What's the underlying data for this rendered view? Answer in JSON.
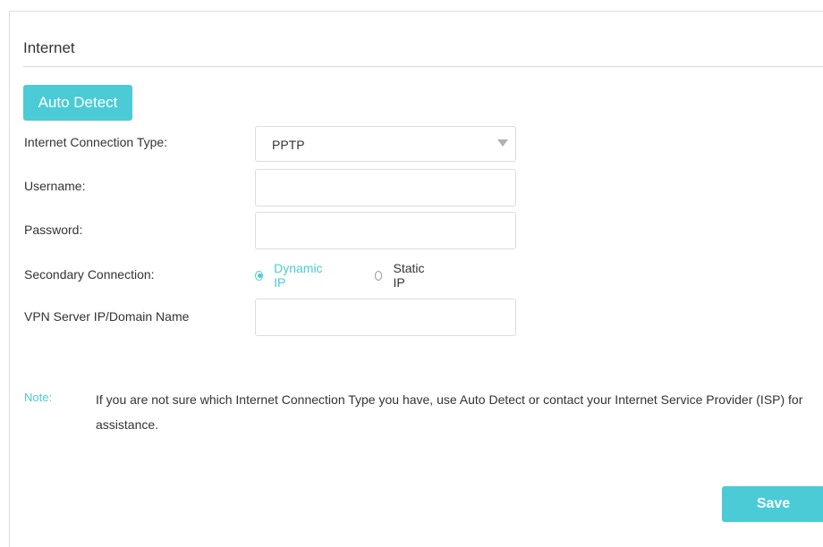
{
  "section": {
    "title": "Internet"
  },
  "auto_detect_label": "Auto Detect",
  "form": {
    "connection_type": {
      "label": "Internet Connection Type:",
      "value": "PPTP"
    },
    "username": {
      "label": "Username:",
      "value": ""
    },
    "password": {
      "label": "Password:",
      "value": ""
    },
    "secondary_connection": {
      "label": "Secondary Connection:",
      "options": [
        {
          "label": "Dynamic IP",
          "selected": true
        },
        {
          "label": "Static IP",
          "selected": false
        }
      ]
    },
    "vpn_server": {
      "label": "VPN Server IP/Domain Name",
      "value": ""
    }
  },
  "note": {
    "label": "Note:",
    "text": "If you are not sure which Internet Connection Type you have, use Auto Detect or contact your Internet Service Provider (ISP) for assistance."
  },
  "save_label": "Save",
  "colors": {
    "accent": "#4acbd6",
    "text": "#333333",
    "border": "#dcdcdc"
  }
}
